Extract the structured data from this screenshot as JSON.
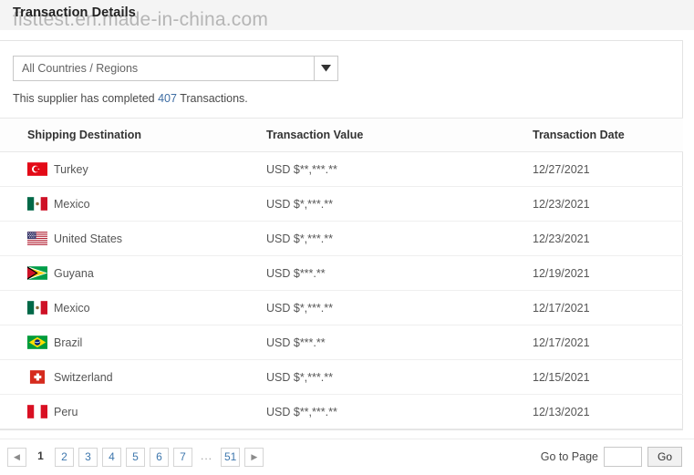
{
  "header": {
    "title": "Transaction Details",
    "watermark": "fisttest.en.made-in-china.com"
  },
  "filter": {
    "selected_region": "All Countries / Regions",
    "arrow_icon": "chevron-down-icon"
  },
  "summary": {
    "prefix": "This supplier has completed ",
    "count": "407",
    "suffix": " Transactions."
  },
  "table": {
    "columns": [
      "Shipping Destination",
      "Transaction Value",
      "Transaction Date"
    ],
    "rows": [
      {
        "flag": "tr",
        "destination": "Turkey",
        "value": "USD $**,***.**",
        "date": "12/27/2021"
      },
      {
        "flag": "mx",
        "destination": "Mexico",
        "value": "USD $*,***.**",
        "date": "12/23/2021"
      },
      {
        "flag": "us",
        "destination": "United States",
        "value": "USD $*,***.**",
        "date": "12/23/2021"
      },
      {
        "flag": "gy",
        "destination": "Guyana",
        "value": "USD $***.**",
        "date": "12/19/2021"
      },
      {
        "flag": "mx",
        "destination": "Mexico",
        "value": "USD $*,***.**",
        "date": "12/17/2021"
      },
      {
        "flag": "br",
        "destination": "Brazil",
        "value": "USD $***.**",
        "date": "12/17/2021"
      },
      {
        "flag": "ch",
        "destination": "Switzerland",
        "value": "USD $*,***.**",
        "date": "12/15/2021"
      },
      {
        "flag": "pe",
        "destination": "Peru",
        "value": "USD $**,***.**",
        "date": "12/13/2021"
      }
    ]
  },
  "pagination": {
    "prev_label": "◀",
    "next_label": "▶",
    "current_page": "1",
    "pages": [
      "2",
      "3",
      "4",
      "5",
      "6",
      "7"
    ],
    "ellipsis": "...",
    "last_page": "51",
    "goto_label": "Go to Page",
    "goto_value": "",
    "goto_placeholder": "",
    "go_button": "Go"
  },
  "colors": {
    "link": "#3e6da3",
    "pager_link": "#3e77ad",
    "band": "#f4f4f4",
    "text": "#555555"
  }
}
